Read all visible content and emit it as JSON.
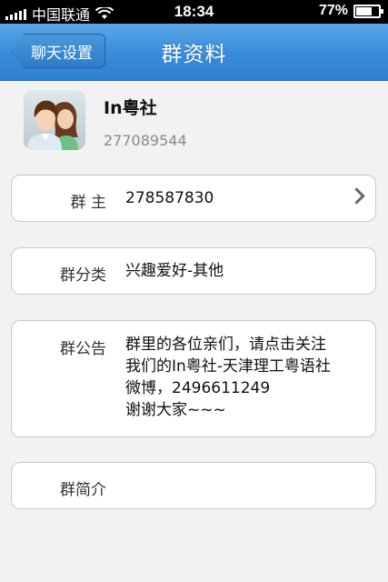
{
  "status_bar": {
    "carrier": "中国联通",
    "time": "18:34",
    "battery": "77%",
    "battery_level": 0.77,
    "icons": [
      "signal-icon",
      "wifi-icon",
      "battery-icon"
    ]
  },
  "nav": {
    "back_label": "聊天设置",
    "title": "群资料"
  },
  "group": {
    "name": "In粤社",
    "id": "277089544"
  },
  "fields": {
    "owner": {
      "label": "群  主",
      "value": "278587830"
    },
    "category": {
      "label": "群分类",
      "value": "兴趣爱好-其他"
    },
    "notice": {
      "label": "群公告",
      "lines": [
        "群里的各位亲们，请点击关注",
        "我们的In粤社-天津理工粤语社",
        "微博，2496611249",
        "谢谢大家~~~"
      ]
    },
    "intro": {
      "label": "群简介",
      "value": ""
    }
  },
  "colors": {
    "nav_blue": "#3a8ddb",
    "background": "#f2f2f2"
  }
}
